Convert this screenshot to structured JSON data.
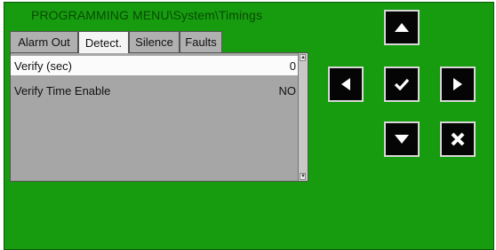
{
  "window": {
    "title": "PROGRAMMING MENU\\System\\Timings"
  },
  "tabs": [
    {
      "label": "Alarm Out",
      "active": false
    },
    {
      "label": "Detect.",
      "active": true
    },
    {
      "label": "Silence",
      "active": false
    },
    {
      "label": "Faults",
      "active": false
    }
  ],
  "settings": [
    {
      "label": "Verify (sec)",
      "value": "0",
      "selected": true
    },
    {
      "label": "Verify Time Enable",
      "value": "NO",
      "selected": false
    }
  ],
  "controls": {
    "up": "arrow-up-icon",
    "down": "arrow-down-icon",
    "left": "arrow-left-icon",
    "right": "arrow-right-icon",
    "confirm": "checkmark-icon",
    "cancel": "cross-icon"
  },
  "colors": {
    "screen_background": "#169c0e",
    "title_text": "#0a4a07",
    "panel_background": "#a6a6a6",
    "selected_row": "#fbfbfb",
    "button_background": "#050505"
  }
}
